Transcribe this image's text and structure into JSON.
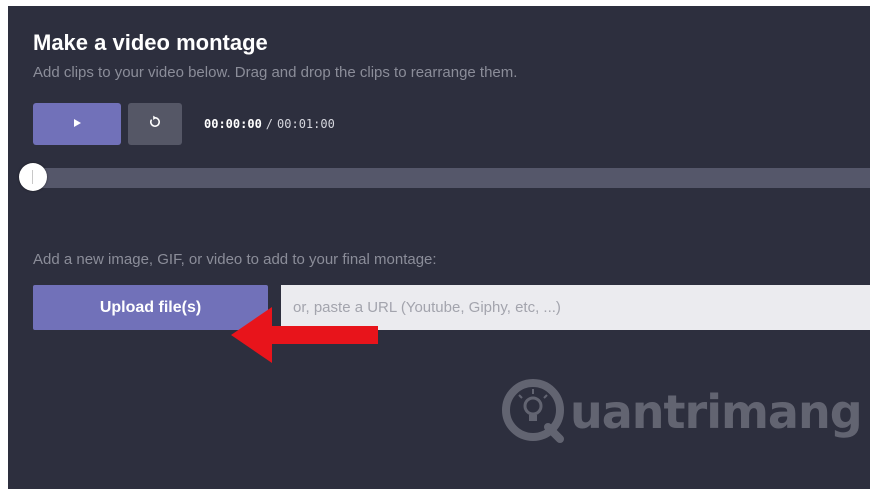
{
  "header": {
    "title": "Make a video montage",
    "subtitle": "Add clips to your video below. Drag and drop the clips to rearrange them."
  },
  "player": {
    "play_icon": "play-icon",
    "reset_icon": "replay-icon",
    "current_time": "00:00:00",
    "separator": "/",
    "total_time": "00:01:00",
    "progress": 0
  },
  "upload": {
    "label": "Add a new image, GIF, or video to add to your final montage:",
    "button_label": "Upload file(s)",
    "url_placeholder": "or, paste a URL (Youtube, Giphy, etc, ...)",
    "url_value": ""
  },
  "annotation": {
    "arrow_icon": "red-arrow-icon",
    "arrow_color": "#e8141b"
  },
  "watermark": {
    "text": "uantrimang",
    "icon": "lightbulb-q-icon"
  },
  "colors": {
    "background": "#2d2f3e",
    "accent": "#7171b9",
    "secondary_button": "#555766"
  }
}
